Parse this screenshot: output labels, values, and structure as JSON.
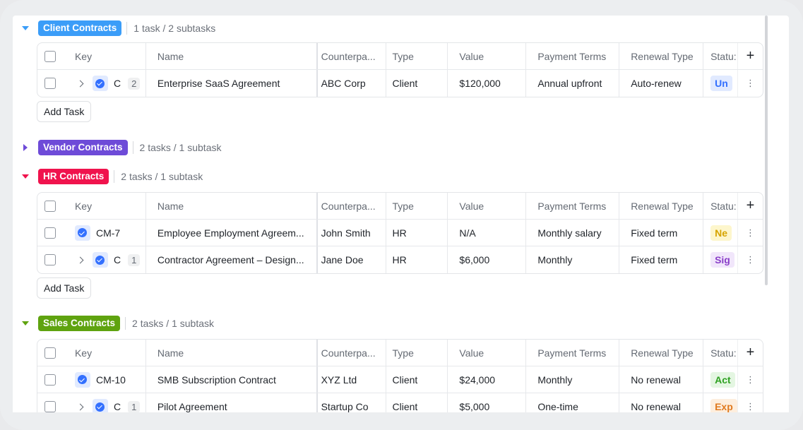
{
  "columns": {
    "key": "Key",
    "name": "Name",
    "counterparty": "Counterpa...",
    "type": "Type",
    "value": "Value",
    "payment_terms": "Payment Terms",
    "renewal_type": "Renewal Type",
    "status": "Statu:"
  },
  "add_task_label": "Add Task",
  "groups": [
    {
      "label": "Client Contracts",
      "color": "#3b9df8",
      "expanded": true,
      "count": "1 task / 2 subtasks",
      "rows": [
        {
          "key": "C",
          "subtasks": "2",
          "has_children": true,
          "name": "Enterprise SaaS Agreement",
          "counterparty": "ABC Corp",
          "type": "Client",
          "value": "$120,000",
          "payment_terms": "Annual upfront",
          "renewal_type": "Auto-renew",
          "status": "Un",
          "status_color": "#3370ff",
          "status_bg": "#e1eaff"
        }
      ]
    },
    {
      "label": "Vendor Contracts",
      "color": "#6e4bd8",
      "expanded": false,
      "count": "2 tasks / 1 subtask"
    },
    {
      "label": "HR Contracts",
      "color": "#f0134d",
      "expanded": true,
      "count": "2 tasks / 1 subtask",
      "rows": [
        {
          "key": "CM-7",
          "subtasks": "",
          "has_children": false,
          "name": "Employee Employment Agreem...",
          "counterparty": "John Smith",
          "type": "HR",
          "value": "N/A",
          "payment_terms": "Monthly salary",
          "renewal_type": "Fixed term",
          "status": "Ne",
          "status_color": "#d6a400",
          "status_bg": "#fdf6cc"
        },
        {
          "key": "C",
          "subtasks": "1",
          "has_children": true,
          "name": "Contractor Agreement – Design...",
          "counterparty": "Jane Doe",
          "type": "HR",
          "value": "$6,000",
          "payment_terms": "Monthly",
          "renewal_type": "Fixed term",
          "status": "Sig",
          "status_color": "#8a3fc9",
          "status_bg": "#f1e6fb"
        }
      ]
    },
    {
      "label": "Sales Contracts",
      "color": "#5fa30f",
      "expanded": true,
      "count": "2 tasks / 1 subtask",
      "rows": [
        {
          "key": "CM-10",
          "subtasks": "",
          "has_children": false,
          "name": "SMB Subscription Contract",
          "counterparty": "XYZ Ltd",
          "type": "Client",
          "value": "$24,000",
          "payment_terms": "Monthly",
          "renewal_type": "No renewal",
          "status": "Act",
          "status_color": "#2ea121",
          "status_bg": "#e4f6e2"
        },
        {
          "key": "C",
          "subtasks": "1",
          "has_children": true,
          "name": "Pilot Agreement",
          "counterparty": "Startup Co",
          "type": "Client",
          "value": "$5,000",
          "payment_terms": "One-time",
          "renewal_type": "No renewal",
          "status": "Exp",
          "status_color": "#e07a1f",
          "status_bg": "#fdeede"
        }
      ]
    }
  ]
}
